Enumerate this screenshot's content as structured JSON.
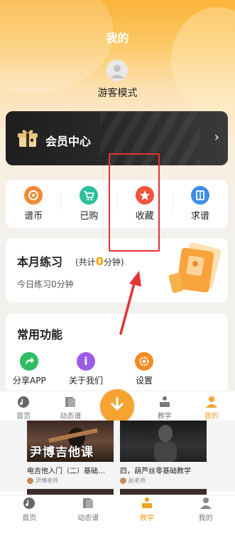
{
  "page": {
    "title": "我的"
  },
  "profile": {
    "username": "游客模式"
  },
  "vip": {
    "label": "会员中心",
    "arrow": "›"
  },
  "quick_actions": [
    {
      "label": "谱币",
      "icon": "coin-icon",
      "color": "#f28a35"
    },
    {
      "label": "已购",
      "icon": "cart-icon",
      "color": "#2bbf9d"
    },
    {
      "label": "收藏",
      "icon": "star-icon",
      "color": "#f0563c"
    },
    {
      "label": "求谱",
      "icon": "book-icon",
      "color": "#3d8ee8"
    }
  ],
  "practice": {
    "title": "本月练习",
    "total_prefix": "(共计",
    "total_value": "0",
    "total_suffix": "分钟)",
    "today": "今日练习0分钟"
  },
  "functions": {
    "title": "常用功能",
    "items": [
      {
        "label": "分享APP",
        "icon": "share-icon",
        "color": "#2ebd63"
      },
      {
        "label": "关于我们",
        "icon": "info-icon",
        "color": "#9b5ce6",
        "glyph": "i"
      },
      {
        "label": "设置",
        "icon": "gear-icon",
        "color": "#f48b22"
      }
    ]
  },
  "overlay_tabbar": [
    {
      "label": "首页",
      "icon": "music-note-icon"
    },
    {
      "label": "动态谱",
      "icon": "sheet-icon"
    },
    {
      "label": "教学",
      "icon": "teaching-icon"
    },
    {
      "label": "我的",
      "icon": "user-icon",
      "active": true
    }
  ],
  "videos": [
    {
      "thumb_text": "尹博吉他课",
      "title": "电吉他入门（二）基础…",
      "author": "尹博老师"
    },
    {
      "thumb_text": "",
      "title": "四，葫芦丝零基础教学",
      "author": "赵老师"
    }
  ],
  "bottom_tabbar": [
    {
      "label": "首页",
      "icon": "music-note-icon"
    },
    {
      "label": "动态谱",
      "icon": "sheet-icon"
    },
    {
      "label": "教学",
      "icon": "teaching-icon",
      "active": true
    },
    {
      "label": "我的",
      "icon": "user-icon"
    }
  ],
  "colors": {
    "accent": "#f6a431",
    "annotation": "#e53232"
  }
}
